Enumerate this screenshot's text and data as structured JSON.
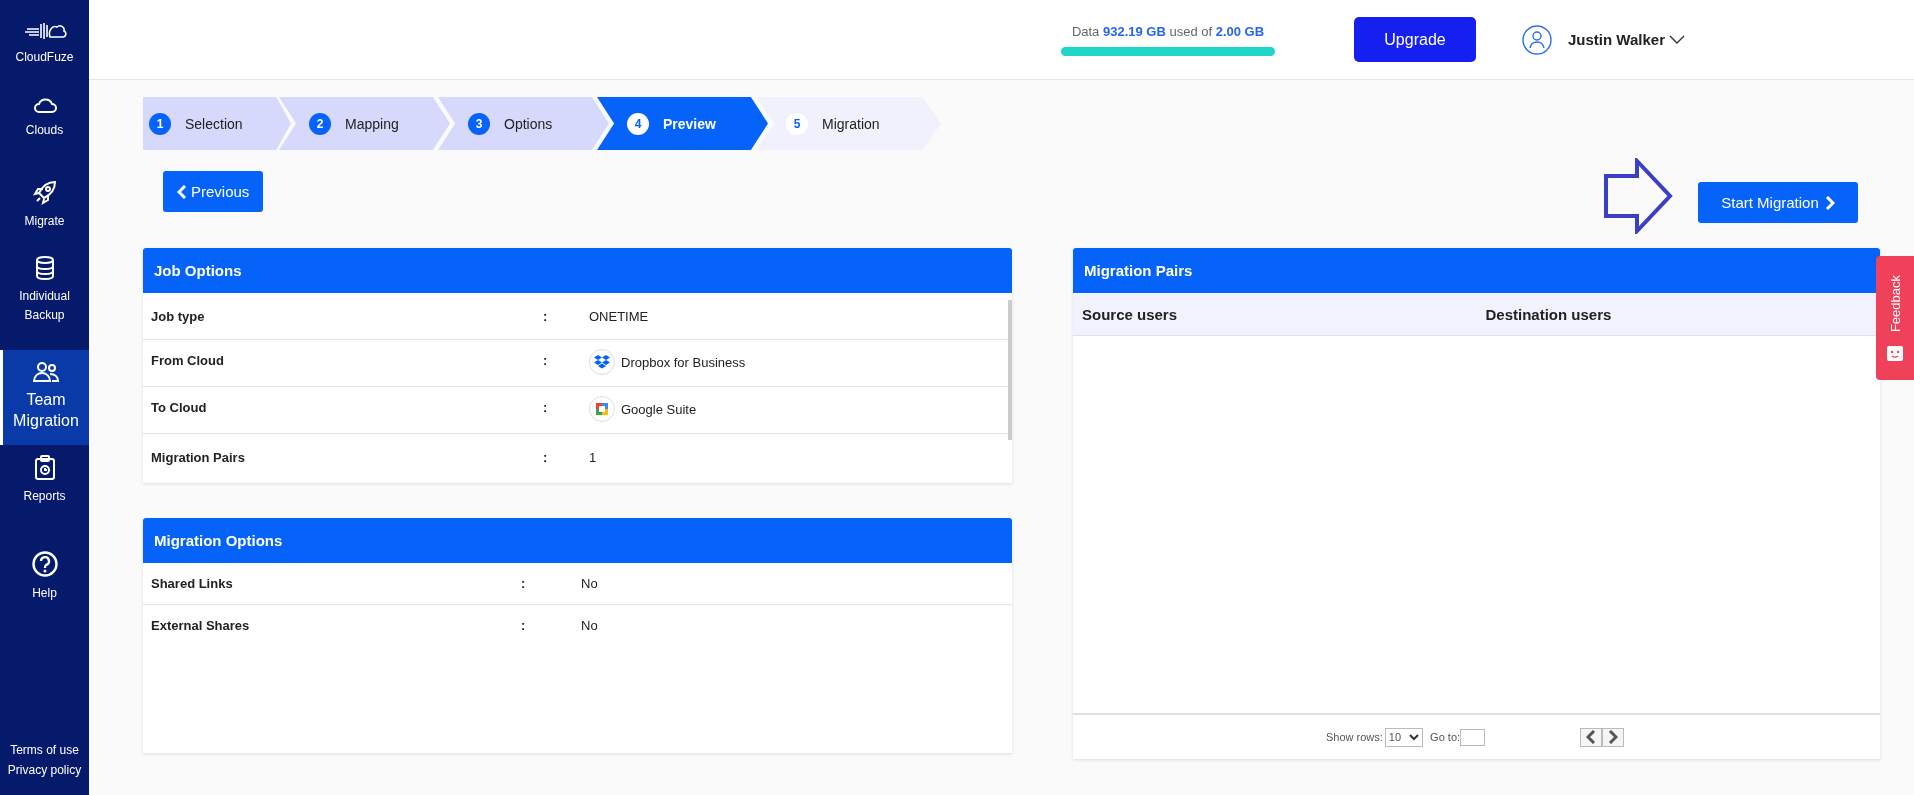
{
  "sidebar": {
    "logo": "CloudFuze",
    "items": [
      {
        "label": "Clouds",
        "selected": false
      },
      {
        "label": "Migrate",
        "selected": false
      },
      {
        "label": "Individual Backup",
        "selected": false
      },
      {
        "label": "Team Migration",
        "selected": true
      },
      {
        "label": "Reports",
        "selected": false
      },
      {
        "label": "Help",
        "selected": false
      }
    ],
    "footer_links": [
      "Terms of use",
      "Privacy policy"
    ]
  },
  "header": {
    "usage": {
      "label": "Data",
      "used": "932.19 GB",
      "middle": "used of",
      "total": "2.00 GB",
      "level": 1
    },
    "upgrade_button": "Upgrade",
    "user": "Justin Walker"
  },
  "steps": [
    {
      "number": "1",
      "label": "Selection",
      "done": true,
      "selected": false
    },
    {
      "number": "2",
      "label": "Mapping",
      "done": true,
      "selected": false
    },
    {
      "number": "3",
      "label": "Options",
      "done": true,
      "selected": false
    },
    {
      "number": "4",
      "label": "Preview",
      "done": false,
      "selected": true
    },
    {
      "number": "5",
      "label": "Migration",
      "done": false,
      "selected": false
    }
  ],
  "previous_button": "Previous",
  "start_button": "Start Migration",
  "job_options": {
    "title": "Job Options",
    "rows": [
      {
        "label": "Job type",
        "separator": ":",
        "value": "ONETIME"
      },
      {
        "label": "From Cloud",
        "separator": ":",
        "value": "Dropbox for Business"
      },
      {
        "label": "To Cloud",
        "separator": ":",
        "value": "Google Suite"
      },
      {
        "label": "Migration Pairs",
        "separator": ":",
        "value": "1"
      }
    ]
  },
  "migration_options": {
    "title": "Migration Options",
    "rows": [
      {
        "label": "Shared Links",
        "separator": ":",
        "value": "No"
      },
      {
        "label": "External Shares",
        "separator": ":",
        "value": "No"
      }
    ]
  },
  "migration_pairs": {
    "title": "Migration Pairs",
    "columns": [
      "Source users",
      "Destination users"
    ],
    "show_rows_label": "Show rows:",
    "show_rows_value": "10",
    "goto_label": "Go to:"
  },
  "feedback": "Feedback"
}
